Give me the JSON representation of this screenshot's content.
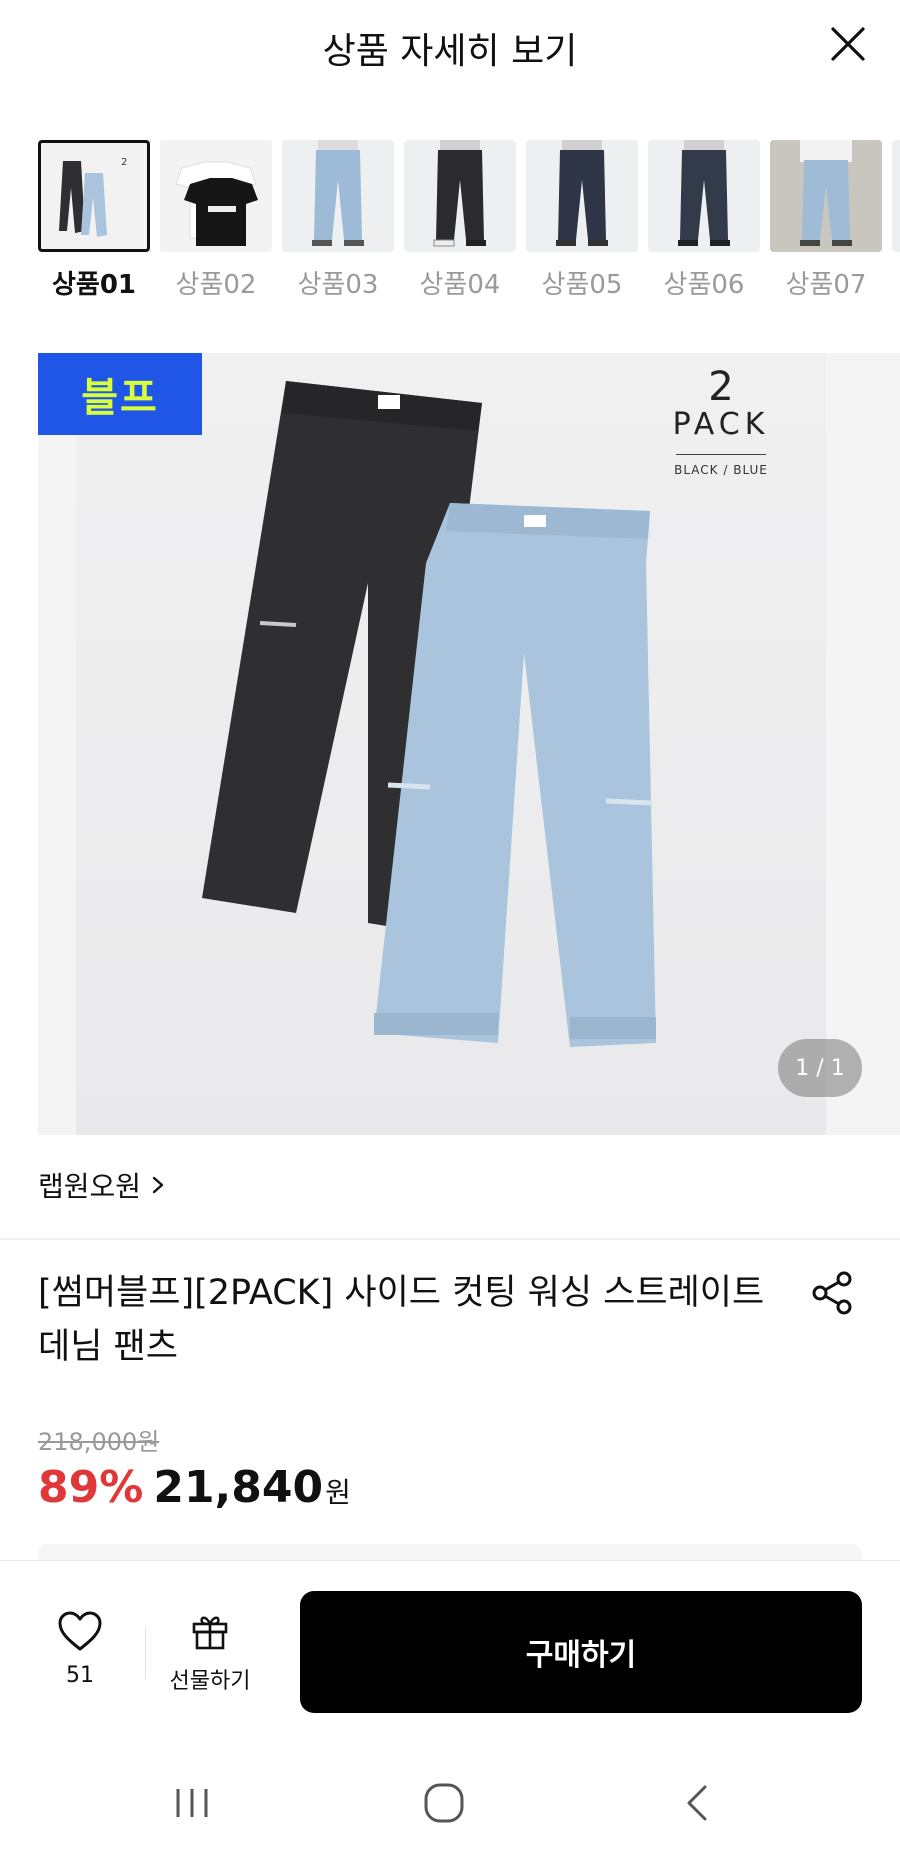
{
  "header": {
    "title": "상품 자세히 보기"
  },
  "thumbnails": [
    {
      "label": "상품01",
      "selected": true
    },
    {
      "label": "상품02",
      "selected": false
    },
    {
      "label": "상품03",
      "selected": false
    },
    {
      "label": "상품04",
      "selected": false
    },
    {
      "label": "상품05",
      "selected": false
    },
    {
      "label": "상품06",
      "selected": false
    },
    {
      "label": "상품07",
      "selected": false
    }
  ],
  "hero": {
    "badge_text": "블프",
    "pack_number": "2",
    "pack_text": "PACK",
    "pack_colors": "BLACK / BLUE",
    "counter": "1 / 1"
  },
  "brand": {
    "name": "랩원오원"
  },
  "product": {
    "title": "[썸머블프][2PACK] 사이드 컷팅 워싱 스트레이트 데님 팬츠",
    "original_price": "218,000원",
    "discount": "89%",
    "sale_price": "21,840",
    "currency": "원"
  },
  "bottom_bar": {
    "like_count": "51",
    "gift_label": "선물하기",
    "buy_label": "구매하기"
  },
  "colors": {
    "discount_red": "#e03838",
    "badge_blue": "#1f56e8",
    "badge_text": "#d9ff3a",
    "black_denim": "#2f2f31",
    "light_denim": "#a9c4dc"
  }
}
